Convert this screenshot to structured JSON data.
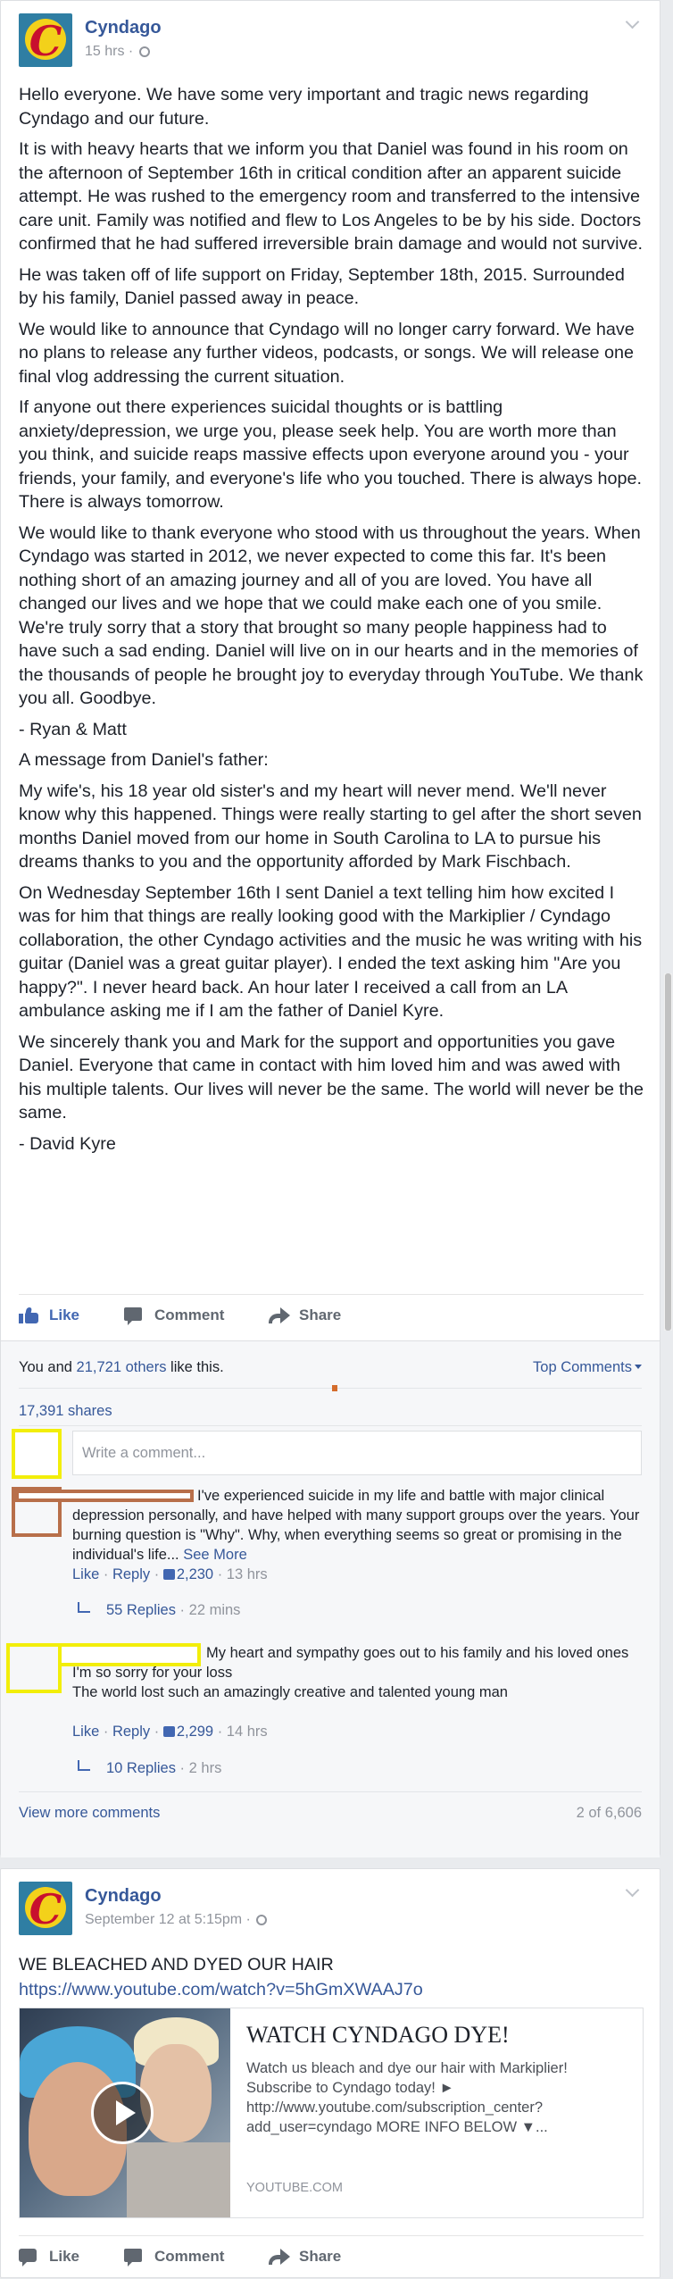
{
  "post1": {
    "page_name": "Cyndago",
    "time": "15 hrs",
    "paragraphs": [
      "Hello everyone. We have some very important and tragic news regarding Cyndago and our future.",
      "It is with heavy hearts that we inform you that Daniel was found in his room on the afternoon of September 16th in critical condition after an apparent suicide attempt. He was rushed to the emergency room and transferred to the intensive care unit. Family was notified and flew to Los Angeles to be by his side. Doctors confirmed that he had suffered irreversible brain damage and would not survive.",
      "He was taken off of life support on Friday, September 18th, 2015. Surrounded by his family, Daniel passed away in peace.",
      "We would like to announce that Cyndago will no longer carry forward. We have no plans to release any further videos, podcasts, or songs. We will release one final vlog addressing the current situation.",
      "If anyone out there experiences suicidal thoughts or is battling anxiety/depression, we urge you, please seek help. You are worth more than you think, and suicide reaps massive effects upon everyone around you - your friends, your family, and everyone's life who you touched. There is always hope. There is always tomorrow.",
      "We would like to thank everyone who stood with us throughout the years. When Cyndago was started in 2012, we never expected to come this far. It's been nothing short of an amazing journey and all of you are loved. You have all changed our lives and we hope that we could make each one of you smile. We're truly sorry that a story that brought so many people happiness had to have such a sad ending. Daniel will live on in our hearts and in the memories of the thousands of people he brought joy to everyday through YouTube. We thank you all. Goodbye.",
      "- Ryan & Matt",
      "A message from Daniel's father:",
      "My wife's, his 18 year old sister's and my heart will never mend. We'll never know why this happened. Things were really starting to gel after the short seven months Daniel moved from our home in South Carolina to LA to pursue his dreams thanks to you and the opportunity afforded by Mark Fischbach.",
      "On Wednesday September 16th I sent Daniel a text telling him how excited I was for him that things are really looking good with the Markiplier / Cyndago collaboration, the other Cyndago activities and the music he was writing with his guitar (Daniel was a great guitar player). I ended the text asking him \"Are you happy?\". I never heard back. An hour later I received a call from an LA ambulance asking me if I am the father of Daniel Kyre.",
      "We sincerely thank you and Mark for the support and opportunities you gave Daniel. Everyone that came in contact with him loved him and was awed with his multiple talents. Our lives will never be the same. The world will never be the same.",
      "- David Kyre"
    ],
    "actions": {
      "like": "Like",
      "comment": "Comment",
      "share": "Share"
    },
    "likes_prefix": "You and ",
    "likes_link": "21,721 others",
    "likes_suffix": " like this.",
    "top_comments": "Top Comments",
    "shares": "17,391 shares",
    "comment_placeholder": "Write a comment...",
    "comments": [
      {
        "text": "I've experienced suicide in my life and battle with major clinical depression personally, and have helped with many support groups over the years. Your burning question is \"Why\". Why, when everything seems so great or promising in the individual's life...",
        "see_more": "See More",
        "like": "Like",
        "reply": "Reply",
        "likes": "2,230",
        "time": "13 hrs",
        "replies": "55 Replies",
        "replies_time": "22 mins"
      },
      {
        "text": "My heart and sympathy goes out to his family and his loved ones\nI'm so sorry for your loss\nThe world lost such an amazingly creative and talented young man",
        "like": "Like",
        "reply": "Reply",
        "likes": "2,299",
        "time": "14 hrs",
        "replies": "10 Replies",
        "replies_time": "2 hrs"
      }
    ],
    "view_more": "View more comments",
    "count": "2 of 6,606"
  },
  "post2": {
    "page_name": "Cyndago",
    "time": "September 12 at 5:15pm",
    "title": "WE BLEACHED AND DYED OUR HAIR",
    "url": "https://www.youtube.com/watch?v=5hGmXWAAJ7o",
    "link_title": "WATCH CYNDAGO DYE!",
    "link_desc": "Watch us bleach and dye our hair with Markiplier! Subscribe to Cyndago today! ►\nhttp://www.youtube.com/subscription_center?add_user=cyndago MORE INFO BELOW ▼...",
    "link_domain": "YOUTUBE.COM",
    "actions": {
      "like": "Like",
      "comment": "Comment",
      "share": "Share"
    }
  },
  "colors": {
    "link": "#365899",
    "like_blue": "#4267b2",
    "highlight_yellow": "#f2ee0a",
    "highlight_brown": "#b86f4a"
  }
}
